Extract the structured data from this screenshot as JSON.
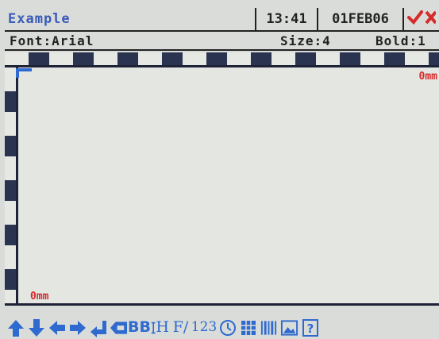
{
  "header": {
    "title": "Example",
    "time": "13:41",
    "date": "01FEB06"
  },
  "actions": {
    "ok_icon": "checkmark-icon",
    "cancel_icon": "cross-icon"
  },
  "info": {
    "font": "Font:Arial",
    "size": "Size:4",
    "bold": "Bold:1"
  },
  "canvas": {
    "top_mm": "0mm",
    "bottom_mm": "0mm"
  },
  "toolbar": {
    "tools": [
      "arrow-up-icon",
      "arrow-down-icon",
      "arrow-left-icon",
      "arrow-right-icon",
      "enter-icon",
      "backspace-icon",
      "double-b-icon",
      "height-icon",
      "font-icon",
      "numeric-icon",
      "clock-icon",
      "table-icon",
      "barcode-icon",
      "image-icon",
      "help-icon"
    ],
    "bb_text": "BB",
    "height_text": "H",
    "font_text": "F/",
    "numeric_text": "123"
  },
  "colors": {
    "accent": "#2f6ad0",
    "title": "#3a5ab8",
    "mm_label": "#d62b2b",
    "background": "#d9dcd8"
  }
}
